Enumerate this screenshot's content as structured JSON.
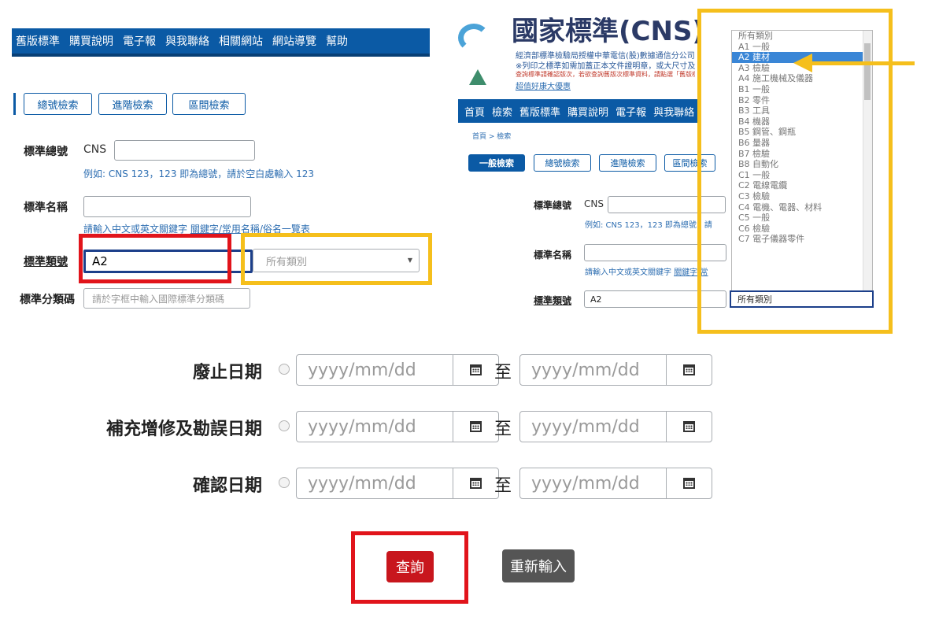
{
  "left": {
    "nav": [
      "舊版標準",
      "購買說明",
      "電子報",
      "與我聯絡",
      "相關網站",
      "網站導覽",
      "幫助"
    ],
    "tabs": [
      "總號檢索",
      "進階檢索",
      "區間檢索"
    ],
    "std_no_label": "標準總號",
    "cns_prefix": "CNS",
    "std_no_hint": "例如: CNS 123，123 即為總號，請於空白處輸入 123",
    "std_name_label": "標準名稱",
    "std_name_hint": "請輸入中文或英文關鍵字",
    "std_name_link": "關鍵字/常用名稱/俗名一覽表",
    "category_label": "標準類號",
    "category_value": "A2",
    "category_select": "所有類別",
    "isc_label": "標準分類碼",
    "isc_placeholder": "請於字框中輸入國際標準分類碼"
  },
  "right": {
    "site_title": "國家標準(CNS)網路",
    "info_line1": "經濟部標準檢驗局授權中華電信(股)數據通信分公司",
    "info_line2": "※列印之標準如需加蓋正本文件證明章，或大尺寸及",
    "info_line3": "查詢標準請確認版次，若欲查詢舊版次標準資料，請點選「舊版標準」",
    "info_link": "超值好康大優惠",
    "nav": [
      "首頁",
      "檢索",
      "舊版標準",
      "購買說明",
      "電子報",
      "與我聯絡"
    ],
    "breadcrumb": "首頁 > 檢索",
    "tabs": [
      "一般檢索",
      "總號檢索",
      "進階檢索",
      "區間檢索"
    ],
    "std_no_label": "標準總號",
    "cns_prefix": "CNS",
    "std_no_hint": "例如: CNS 123，123 即為總號，請",
    "std_name_label": "標準名稱",
    "std_name_hint": "請輸入中文或英文關鍵字",
    "std_name_link": "關鍵字/常",
    "category_label": "標準類號",
    "category_value": "A2",
    "category_select": "所有類別",
    "dropdown_items": [
      "所有類別",
      "A1 一般",
      "A2 建材",
      "A3 檢驗",
      "A4 施工機械及儀器",
      "B1 一般",
      "B2 零件",
      "B3 工具",
      "B4 機器",
      "B5 鋼管、鋼瓶",
      "B6 量器",
      "B7 檢驗",
      "B8 自動化",
      "C1 一般",
      "C2 電線電纜",
      "C3 檢驗",
      "C4 電機、電器、材料",
      "C5 一般",
      "C6 檢驗",
      "C7 電子儀器零件"
    ],
    "dropdown_selected": "A2 建材"
  },
  "dates": {
    "rows": [
      "廢止日期",
      "補充增修及勘誤日期",
      "確認日期"
    ],
    "placeholder": "yyyy/mm/dd",
    "to": "至"
  },
  "buttons": {
    "query": "查詢",
    "reset": "重新輸入"
  },
  "colors": {
    "nav_blue": "#0b5aa5",
    "highlight_red": "#e1141b",
    "highlight_yellow": "#f5bf1c",
    "query_red": "#c8161d"
  }
}
